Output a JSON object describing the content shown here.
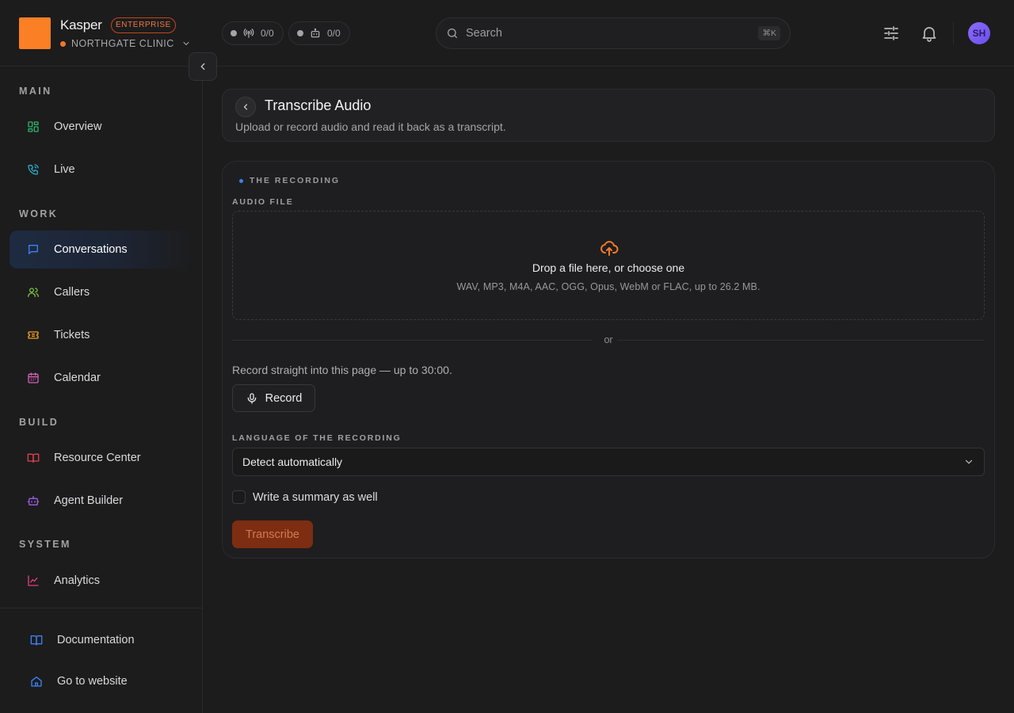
{
  "brand": {
    "name": "Kasper",
    "plan": "ENTERPRISE",
    "org": "NORTHGATE CLINIC"
  },
  "status_counters": [
    {
      "icon": "antenna-icon",
      "value": "0/0"
    },
    {
      "icon": "robot-icon",
      "value": "0/0"
    }
  ],
  "search": {
    "placeholder": "Search",
    "shortcut": "⌘K"
  },
  "user": {
    "initials": "SH"
  },
  "sidebar": {
    "sections": [
      {
        "label": "MAIN",
        "items": [
          {
            "label": "Overview",
            "icon": "grid-icon",
            "color": "#2fb36b"
          },
          {
            "label": "Live",
            "icon": "phone-call-icon",
            "color": "#2aaac4"
          }
        ]
      },
      {
        "label": "WORK",
        "items": [
          {
            "label": "Conversations",
            "icon": "chat-icon",
            "color": "#3b82f6",
            "active": true
          },
          {
            "label": "Callers",
            "icon": "users-icon",
            "color": "#7bc043"
          },
          {
            "label": "Tickets",
            "icon": "ticket-icon",
            "color": "#f0a020"
          },
          {
            "label": "Calendar",
            "icon": "calendar-icon",
            "color": "#d35fb7"
          }
        ]
      },
      {
        "label": "BUILD",
        "items": [
          {
            "label": "Resource Center",
            "icon": "book-icon",
            "color": "#e0414b"
          },
          {
            "label": "Agent Builder",
            "icon": "robot-icon",
            "color": "#9d5ce6"
          }
        ]
      },
      {
        "label": "SYSTEM",
        "items": [
          {
            "label": "Analytics",
            "icon": "chart-line-icon",
            "color": "#e0407a"
          }
        ]
      }
    ],
    "footer": [
      {
        "label": "Documentation",
        "icon": "book-open-icon",
        "color": "#3b82f6"
      },
      {
        "label": "Go to website",
        "icon": "home-icon",
        "color": "#3b82f6"
      }
    ]
  },
  "page": {
    "title": "Transcribe Audio",
    "subtitle": "Upload or record audio and read it back as a transcript."
  },
  "form": {
    "section_title": "THE RECORDING",
    "audio_label": "AUDIO FILE",
    "dropzone_title": "Drop a file here, or choose one",
    "dropzone_hint": "WAV, MP3, M4A, AAC, OGG, Opus, WebM or FLAC, up to 26.2 MB.",
    "or": "or",
    "record_hint": "Record straight into this page — up to 30:00.",
    "record_button": "Record",
    "language_label": "LANGUAGE OF THE RECORDING",
    "language_value": "Detect automatically",
    "summary_label": "Write a summary as well",
    "summary_checked": false,
    "submit": "Transcribe"
  },
  "colors": {
    "accent": "#fb7f24",
    "primary_button": "#7d2d11",
    "active_nav": "#1e2b40"
  }
}
